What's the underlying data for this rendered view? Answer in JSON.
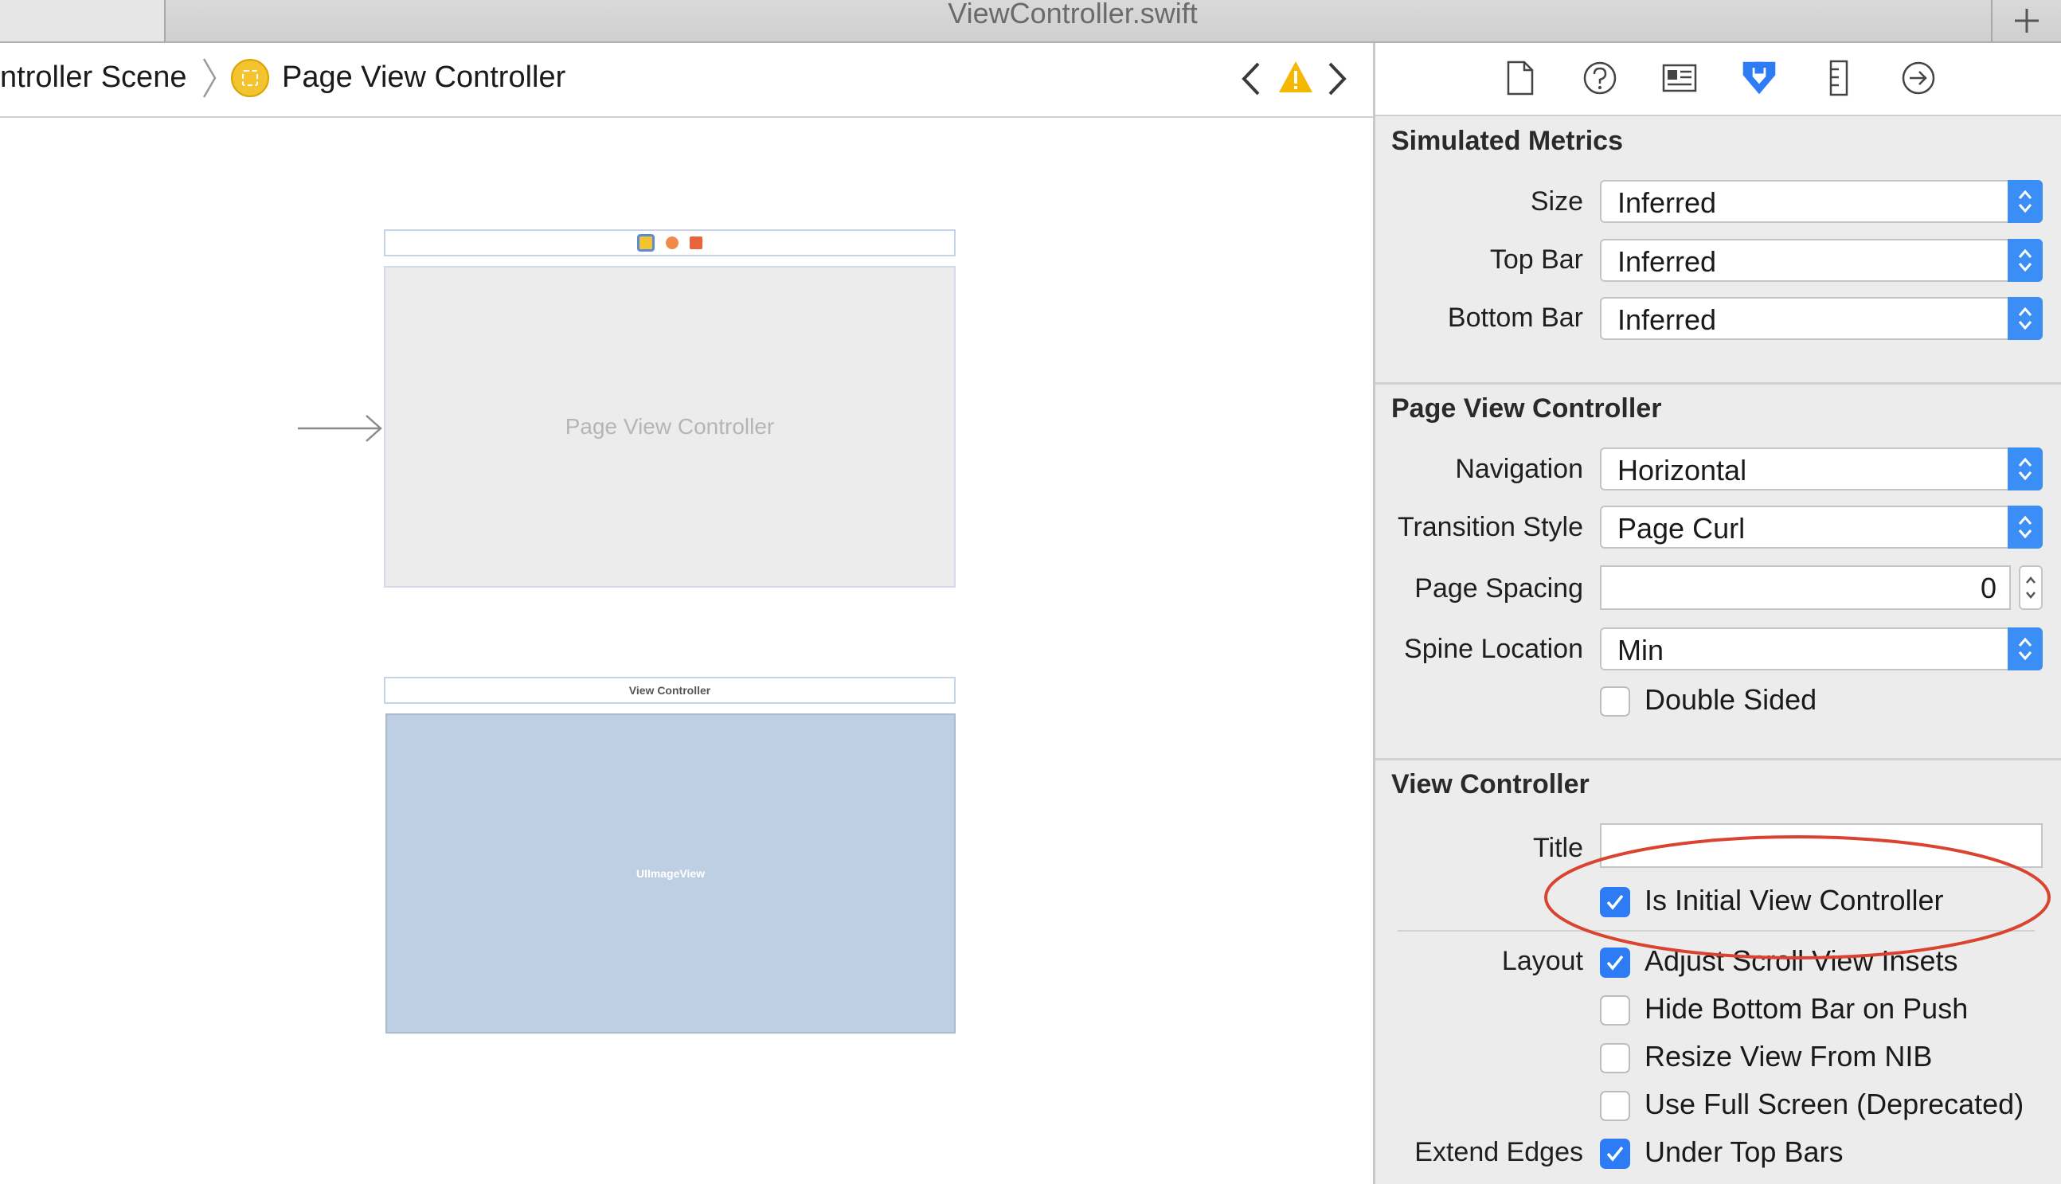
{
  "window": {
    "title": "ViewController.swift",
    "add_tab_label": "+"
  },
  "jumpbar": {
    "scene_crumb": "ntroller Scene",
    "current_crumb": "Page View Controller"
  },
  "canvas": {
    "page_view_controller_label": "Page View Controller",
    "view_controller_dock_label": "View Controller",
    "image_view_label": "UIImageView"
  },
  "inspector": {
    "toolbar_icons": [
      "file-icon",
      "help-icon",
      "identity-icon",
      "attributes-icon",
      "size-icon",
      "connections-icon"
    ],
    "simulated_metrics": {
      "title": "Simulated Metrics",
      "size_label": "Size",
      "size_value": "Inferred",
      "top_bar_label": "Top Bar",
      "top_bar_value": "Inferred",
      "bottom_bar_label": "Bottom Bar",
      "bottom_bar_value": "Inferred"
    },
    "page_view_controller": {
      "title": "Page View Controller",
      "navigation_label": "Navigation",
      "navigation_value": "Horizontal",
      "transition_label": "Transition Style",
      "transition_value": "Page Curl",
      "spacing_label": "Page Spacing",
      "spacing_value": "0",
      "spine_label": "Spine Location",
      "spine_value": "Min",
      "double_sided_label": "Double Sided",
      "double_sided_checked": false
    },
    "view_controller": {
      "title": "View Controller",
      "title_label": "Title",
      "title_value": "",
      "initial_label": "Is Initial View Controller",
      "initial_checked": true,
      "layout_label": "Layout",
      "layout_options": [
        {
          "label": "Adjust Scroll View Insets",
          "checked": true
        },
        {
          "label": "Hide Bottom Bar on Push",
          "checked": false
        },
        {
          "label": "Resize View From NIB",
          "checked": false
        },
        {
          "label": "Use Full Screen (Deprecated)",
          "checked": false
        }
      ],
      "extend_edges_label": "Extend Edges",
      "extend_edges_options": [
        {
          "label": "Under Top Bars",
          "checked": true
        }
      ]
    }
  },
  "colors": {
    "accent": "#2d7cf6",
    "highlight_ellipse": "#d9432f",
    "warning": "#f5b800"
  }
}
